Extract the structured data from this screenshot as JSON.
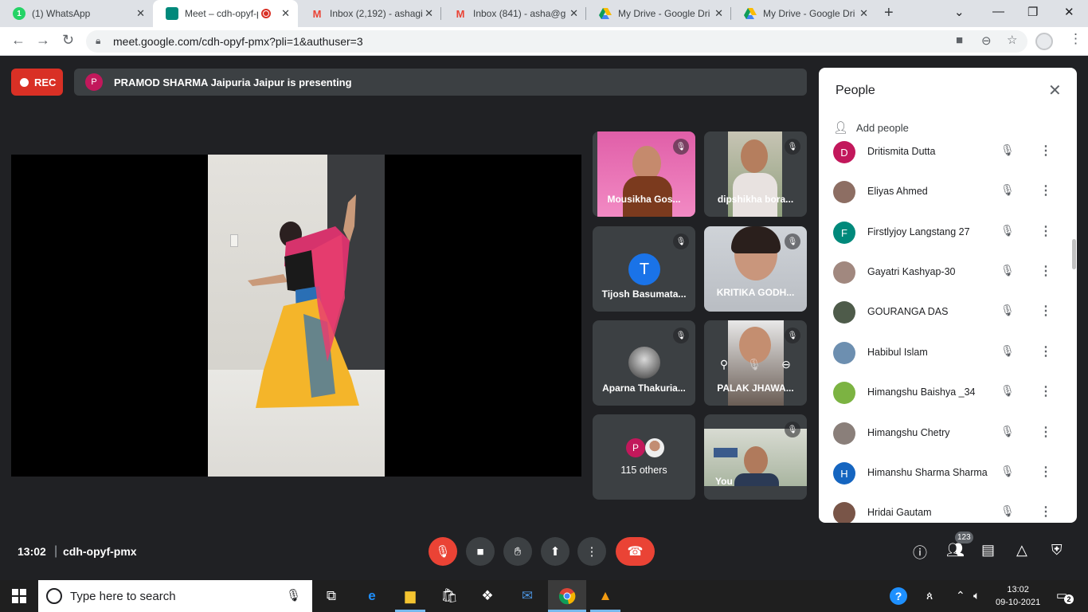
{
  "browser": {
    "tabs": [
      {
        "title": "(1) WhatsApp",
        "icon": "whatsapp-icon",
        "color": "#25d366"
      },
      {
        "title": "Meet – cdh-opyf-pmx",
        "icon": "google-meet-icon",
        "color": "#00897b"
      },
      {
        "title": "Inbox (2,192) - ashagi",
        "icon": "gmail-icon",
        "color": "#ea4335"
      },
      {
        "title": "Inbox (841) - asha@g",
        "icon": "gmail-icon",
        "color": "#ea4335"
      },
      {
        "title": "My Drive - Google Dri",
        "icon": "google-drive-icon",
        "color": "#fbbc04"
      },
      {
        "title": "My Drive - Google Dri",
        "icon": "google-drive-icon",
        "color": "#fbbc04"
      }
    ],
    "url": "meet.google.com/cdh-opyf-pmx?pli=1&authuser=3"
  },
  "meet": {
    "rec_label": "REC",
    "presenting": {
      "avatar_letter": "P",
      "text": "PRAMOD SHARMA Jaipuria Jaipur is presenting"
    },
    "tiles": [
      {
        "name": "Mousikha Gos...",
        "type": "video"
      },
      {
        "name": "dipshikha bora...",
        "type": "video"
      },
      {
        "name": "Tijosh Basumata...",
        "type": "avatar",
        "letter": "T"
      },
      {
        "name": "KRITIKA GODH...",
        "type": "video"
      },
      {
        "name": "Aparna Thakuria...",
        "type": "photo"
      },
      {
        "name": "PALAK JHAWA...",
        "type": "video"
      },
      {
        "name": "115 others",
        "type": "others"
      },
      {
        "name": "You",
        "type": "video"
      }
    ],
    "others_avatar_letter": "P",
    "meeting_time": "13:02",
    "separator": "|",
    "meeting_code": "cdh-opyf-pmx",
    "people_count": "123"
  },
  "people_panel": {
    "title": "People",
    "add_people_label": "Add people",
    "participants": [
      {
        "name": "Dritismita Dutta",
        "letter": "D",
        "color": "#c2185b"
      },
      {
        "name": "Eliyas Ahmed",
        "letter": "",
        "color": "#8d6e63"
      },
      {
        "name": "Firstlyjoy Langstang 27",
        "letter": "F",
        "color": "#00897b"
      },
      {
        "name": "Gayatri Kashyap-30",
        "letter": "",
        "color": "#a1887f"
      },
      {
        "name": "GOURANGA DAS",
        "letter": "",
        "color": "#4e5b4a"
      },
      {
        "name": "Habibul Islam",
        "letter": "",
        "color": "#6d8fb0"
      },
      {
        "name": "Himangshu Baishya _34",
        "letter": "",
        "color": "#7cb342"
      },
      {
        "name": "Himangshu Chetry",
        "letter": "",
        "color": "#8a7f7a"
      },
      {
        "name": "Himanshu Sharma Sharma",
        "letter": "H",
        "color": "#1565c0"
      },
      {
        "name": "Hridai Gautam",
        "letter": "",
        "color": "#795548"
      }
    ]
  },
  "taskbar": {
    "search_placeholder": "Type here to search",
    "time": "13:02",
    "date": "09-10-2021",
    "notification_count": "2"
  }
}
